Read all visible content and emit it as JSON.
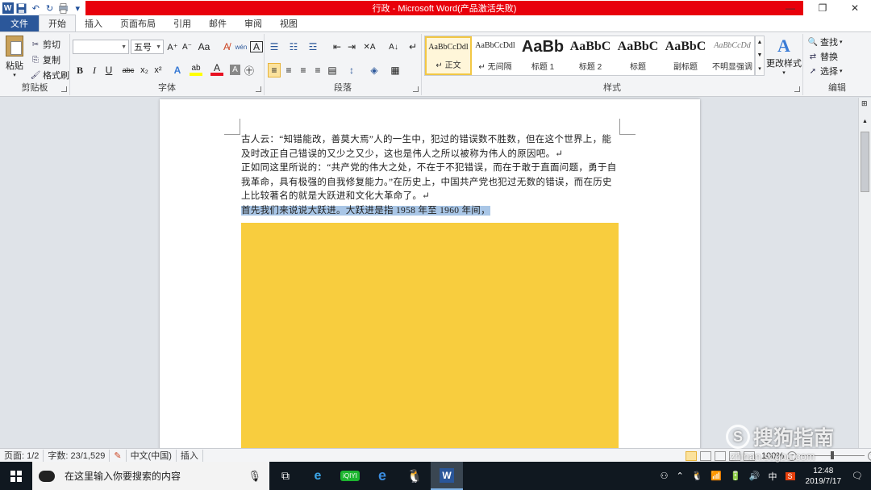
{
  "titlebar": {
    "title": "行政 - Microsoft Word(产品激活失败)",
    "word_icon": "W",
    "minimize_glyph": "—",
    "restore_glyph": "❐",
    "close_glyph": "✕"
  },
  "quick_access": {
    "save_glyph": "💾",
    "undo_glyph": "↶",
    "redo_glyph": "↻",
    "customize_glyph": "▾"
  },
  "tabs": [
    {
      "label": "文件"
    },
    {
      "label": "开始"
    },
    {
      "label": "插入"
    },
    {
      "label": "页面布局"
    },
    {
      "label": "引用"
    },
    {
      "label": "邮件"
    },
    {
      "label": "审阅"
    },
    {
      "label": "视图"
    }
  ],
  "clipboard": {
    "paste": "粘贴",
    "cut": "剪切",
    "copy": "复制",
    "format_painter": "格式刷",
    "group": "剪贴板"
  },
  "font": {
    "name": "",
    "size": "五号",
    "group": "字体",
    "grow": "A⁺",
    "shrink": "A⁻",
    "case": "Aa",
    "clear": "A̸",
    "phonetic": "wén",
    "charborder": "A",
    "bold": "B",
    "italic": "I",
    "underline": "U",
    "strike": "abc",
    "subscript": "x₂",
    "superscript": "x²",
    "effects": "A",
    "highlight": "ab",
    "fontcolor": "A",
    "charshade": "A",
    "enclose": "㊉",
    "fontcolor_color": "#e81123",
    "highlight_color": "#ffff00"
  },
  "paragraph": {
    "group": "段落",
    "bullets": "☰",
    "numbering": "☷",
    "multilevel": "☲",
    "decrease_indent": "⇤",
    "increase_indent": "⇥",
    "chinese_layout": "✕A",
    "sort": "A↓",
    "show_marks": "↵",
    "align_left": "≡",
    "center": "≡",
    "align_right": "≡",
    "justify": "≡",
    "distributed": "▤",
    "line_spacing": "↕",
    "shading": "◈",
    "borders": "▦"
  },
  "styles": {
    "group": "样式",
    "items": [
      {
        "sample": "AaBbCcDdl",
        "name": "↵ 正文",
        "size": "10px",
        "weight": "normal"
      },
      {
        "sample": "AaBbCcDdl",
        "name": "↵ 无间隔",
        "size": "10px",
        "weight": "normal"
      },
      {
        "sample": "AaBb",
        "name": "标题 1",
        "size": "20px",
        "weight": "bold"
      },
      {
        "sample": "AaBbC",
        "name": "标题 2",
        "size": "16px",
        "weight": "bold"
      },
      {
        "sample": "AaBbC",
        "name": "标题",
        "size": "16px",
        "weight": "bold"
      },
      {
        "sample": "AaBbC",
        "name": "副标题",
        "size": "16px",
        "weight": "bold"
      },
      {
        "sample": "AaBbCcDd",
        "name": "不明显强调",
        "size": "10px",
        "weight": "normal"
      }
    ],
    "change_styles": "更改样式",
    "change_glyph": "A"
  },
  "editing": {
    "group": "编辑",
    "find": "查找",
    "replace": "替换",
    "select": "选择"
  },
  "document": {
    "paragraphs": [
      [
        "古人云：“知错能改，善莫大焉”人的一生中，犯过的错误数不胜数，但在这个世界上，能",
        "及时改正自己错误的又少之又少，这也是伟人之所以被称为伟人的原因吧。↵"
      ],
      [
        "正如同这里所说的：“共产党的伟大之处，不在于不犯错误，而在于敢于直面问题，勇于自",
        "我革命，具有极强的自我修复能力。”在历史上，中国共产党也犯过无数的错误，而在历史",
        "上比较著名的就是大跃进和文化大革命了。↵"
      ]
    ],
    "selected_line": "首先我们来说说大跃进。大跃进是指 1958 年至 1960 年间，",
    "image_color": "#f8cd3e"
  },
  "statusbar": {
    "page": "页面: 1/2",
    "words": "字数: 23/1,529",
    "lang": "中文(中国)",
    "mode": "插入",
    "zoom": "100%",
    "zoom_out": "−",
    "zoom_in": "+"
  },
  "taskbar": {
    "search_placeholder": "在这里输入你要搜索的内容",
    "ime": "中",
    "time": "12:48",
    "date": "2019/7/17",
    "apps": [
      "task-view",
      "ie",
      "iqiyi",
      "edge",
      "qq",
      "word"
    ]
  },
  "watermark": {
    "text": "搜狗指南",
    "url": "zhinan.sogou.com"
  }
}
